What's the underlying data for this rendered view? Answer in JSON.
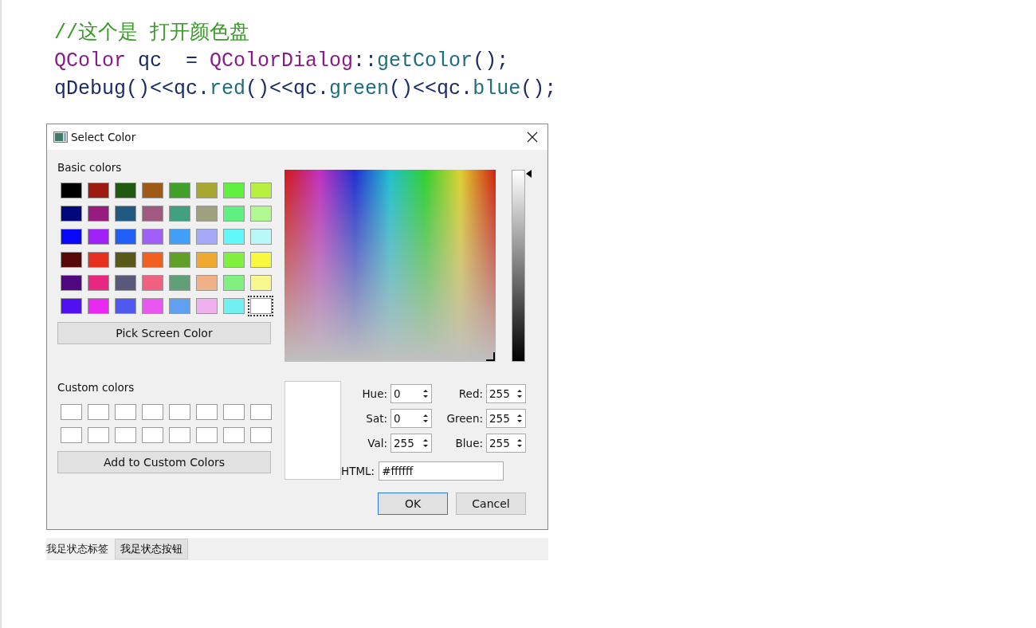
{
  "code_lines": [
    [
      {
        "text": "//这个是 打开颜色盘",
        "kind": "comment"
      }
    ],
    [
      {
        "text": "QColor",
        "kind": "type"
      },
      {
        "text": " qc  = ",
        "kind": "plain"
      },
      {
        "text": "QColorDialog",
        "kind": "type"
      },
      {
        "text": "::",
        "kind": "plain"
      },
      {
        "text": "getColor",
        "kind": "method"
      },
      {
        "text": "();",
        "kind": "plain"
      }
    ],
    [
      {
        "text": "qDebug",
        "kind": "plain"
      },
      {
        "text": "()<<qc.",
        "kind": "plain"
      },
      {
        "text": "red",
        "kind": "method"
      },
      {
        "text": "()<<qc.",
        "kind": "plain"
      },
      {
        "text": "green",
        "kind": "method"
      },
      {
        "text": "()<<qc.",
        "kind": "plain"
      },
      {
        "text": "blue",
        "kind": "method"
      },
      {
        "text": "();",
        "kind": "plain"
      }
    ]
  ],
  "dialog": {
    "title": "Select Color",
    "basic_colors_label": "Basic colors",
    "basic_colors": [
      {
        "color": "#000000",
        "selected": false
      },
      {
        "color": "#9c1a10",
        "selected": false
      },
      {
        "color": "#1f5a10",
        "selected": false
      },
      {
        "color": "#a05a18",
        "selected": false
      },
      {
        "color": "#40a028",
        "selected": false
      },
      {
        "color": "#a8a830",
        "selected": false
      },
      {
        "color": "#60f040",
        "selected": false
      },
      {
        "color": "#b8f040",
        "selected": false
      },
      {
        "color": "#00087c",
        "selected": false
      },
      {
        "color": "#981c80",
        "selected": false
      },
      {
        "color": "#205a80",
        "selected": false
      },
      {
        "color": "#a05a80",
        "selected": false
      },
      {
        "color": "#40a080",
        "selected": false
      },
      {
        "color": "#a0a080",
        "selected": false
      },
      {
        "color": "#60f080",
        "selected": false
      },
      {
        "color": "#b0f890",
        "selected": false
      },
      {
        "color": "#0808f8",
        "selected": false
      },
      {
        "color": "#a020f8",
        "selected": false
      },
      {
        "color": "#2060f8",
        "selected": false
      },
      {
        "color": "#a060f8",
        "selected": false
      },
      {
        "color": "#40a0f8",
        "selected": false
      },
      {
        "color": "#a8a8f8",
        "selected": false
      },
      {
        "color": "#60f8f8",
        "selected": false
      },
      {
        "color": "#b8f8f8",
        "selected": false
      },
      {
        "color": "#580808",
        "selected": false
      },
      {
        "color": "#e83020",
        "selected": false
      },
      {
        "color": "#585818",
        "selected": false
      },
      {
        "color": "#f06020",
        "selected": false
      },
      {
        "color": "#60a028",
        "selected": false
      },
      {
        "color": "#f0a830",
        "selected": false
      },
      {
        "color": "#80f040",
        "selected": false
      },
      {
        "color": "#f8f840",
        "selected": false
      },
      {
        "color": "#500880",
        "selected": false
      },
      {
        "color": "#e82880",
        "selected": false
      },
      {
        "color": "#585878",
        "selected": false
      },
      {
        "color": "#f06080",
        "selected": false
      },
      {
        "color": "#60a078",
        "selected": false
      },
      {
        "color": "#f0b088",
        "selected": false
      },
      {
        "color": "#80f080",
        "selected": false
      },
      {
        "color": "#f8f890",
        "selected": false
      },
      {
        "color": "#5010f0",
        "selected": false
      },
      {
        "color": "#e828f0",
        "selected": false
      },
      {
        "color": "#5058f0",
        "selected": false
      },
      {
        "color": "#e858f0",
        "selected": false
      },
      {
        "color": "#60a0f0",
        "selected": false
      },
      {
        "color": "#f0b0f0",
        "selected": false
      },
      {
        "color": "#70f0f0",
        "selected": false
      },
      {
        "color": "#ffffff",
        "selected": true
      }
    ],
    "pick_button": "Pick Screen Color",
    "custom_colors_label": "Custom colors",
    "custom_colors": [
      {
        "color": "#ffffff"
      },
      {
        "color": "#ffffff"
      },
      {
        "color": "#ffffff"
      },
      {
        "color": "#ffffff"
      },
      {
        "color": "#ffffff"
      },
      {
        "color": "#ffffff"
      },
      {
        "color": "#ffffff"
      },
      {
        "color": "#ffffff"
      },
      {
        "color": "#ffffff"
      },
      {
        "color": "#ffffff"
      },
      {
        "color": "#ffffff"
      },
      {
        "color": "#ffffff"
      },
      {
        "color": "#ffffff"
      },
      {
        "color": "#ffffff"
      },
      {
        "color": "#ffffff"
      },
      {
        "color": "#ffffff"
      }
    ],
    "add_button": "Add to Custom Colors",
    "fields": [
      {
        "label": "Hue:",
        "value": "0"
      },
      {
        "label": "Red:",
        "value": "255"
      },
      {
        "label": "Sat:",
        "value": "0"
      },
      {
        "label": "Green:",
        "value": "255"
      },
      {
        "label": "Val:",
        "value": "255"
      },
      {
        "label": "Blue:",
        "value": "255"
      }
    ],
    "html": {
      "label": "HTML:",
      "value": "#ffffff"
    },
    "buttons": [
      {
        "label": "OK",
        "default": true
      },
      {
        "label": "Cancel",
        "default": false
      }
    ]
  },
  "status_bar": {
    "label": "我足状态标签",
    "button": "我足状态按钮"
  }
}
